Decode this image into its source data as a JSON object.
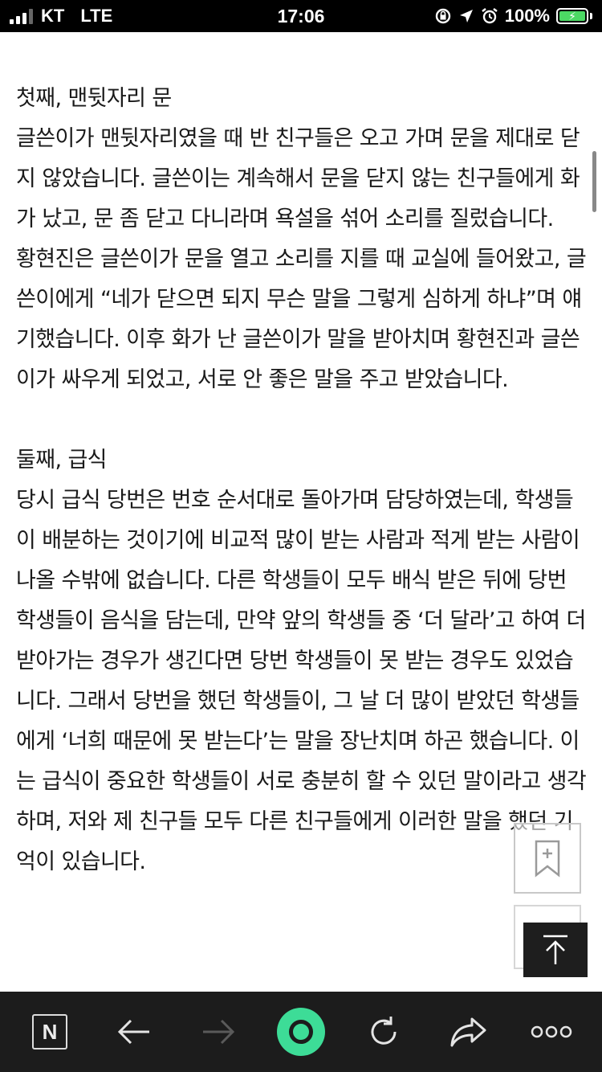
{
  "status_bar": {
    "carrier": "KT",
    "network": "LTE",
    "time": "17:06",
    "battery": "100%",
    "icons": [
      "signal-bars-icon",
      "orientation-lock-icon",
      "location-arrow-icon",
      "alarm-icon",
      "battery-charging-icon"
    ]
  },
  "article": {
    "section1_title": "첫째, 맨뒷자리 문",
    "section1_body1": "글쓴이가 맨뒷자리였을 때 반 친구들은 오고 가며 문을 제대로 닫지 않았습니다. 글쓴이는 계속해서 문을 닫지 않는 친구들에게 화가 났고, 문 좀 닫고 다니라며 욕설을 섞어 소리를 질렀습니다.",
    "section1_body2": "황현진은 글쓴이가 문을 열고 소리를 지를 때 교실에 들어왔고, 글쓴이에게 “네가 닫으면 되지 무슨 말을 그렇게 심하게 하냐”며 얘기했습니다. 이후 화가 난 글쓴이가 말을 받아치며 황현진과 글쓴이가 싸우게 되었고, 서로 안 좋은 말을 주고 받았습니다.",
    "section2_title": "둘째, 급식",
    "section2_body": "당시 급식 당번은 번호 순서대로 돌아가며 담당하였는데, 학생들이 배분하는 것이기에 비교적 많이 받는 사람과 적게 받는 사람이 나올 수밖에 없습니다. 다른 학생들이 모두 배식 받은 뒤에 당번 학생들이 음식을 담는데, 만약 앞의 학생들 중 ‘더 달라’고 하여 더 받아가는 경우가 생긴다면 당번 학생들이 못 받는 경우도 있었습니다. 그래서 당번을 했던 학생들이, 그 날 더 많이 받았던 학생들에게 ‘너희 때문에 못 받는다’는 말을 장난치며 하곤 했습니다. 이는 급식이 중요한 학생들이 서로 충분히 할 수 있던 말이라고 생각하며, 저와 제 친구들 모두 다른 친구들에게 이러한 말을 했던 기억이 있습니다."
  },
  "floating": {
    "bookmark_icon": "bookmark-add-icon",
    "top_icon": "scroll-to-top-icon"
  },
  "toolbar": {
    "items": [
      "naver-home-icon",
      "back-arrow-icon",
      "forward-arrow-icon",
      "green-dot-button-icon",
      "refresh-icon",
      "share-icon",
      "more-icon"
    ],
    "home_letter": "N",
    "accent": "#3ddc97"
  }
}
